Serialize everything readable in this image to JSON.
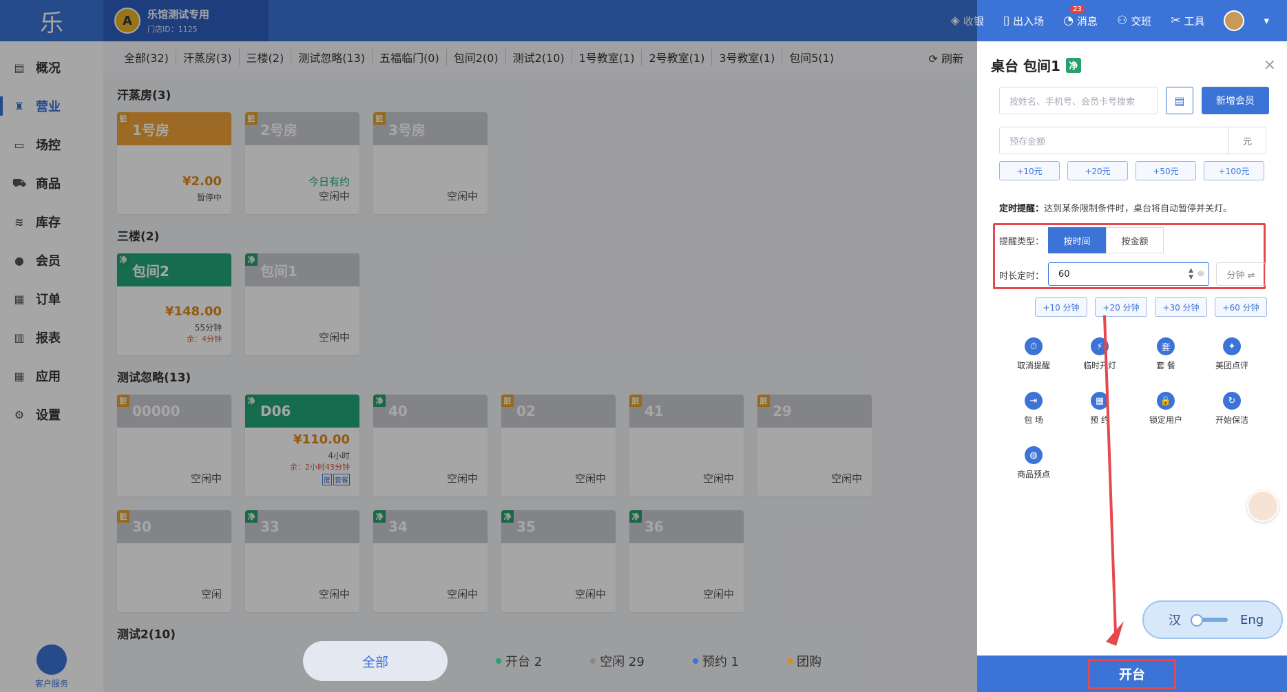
{
  "topbar": {
    "logo": "乐",
    "store_avatar": "A",
    "store_name": "乐馆测试专用",
    "store_id": "门店ID：1125",
    "actions": [
      {
        "icon": "cashier-icon",
        "label": "收银"
      },
      {
        "icon": "door-icon",
        "label": "出入场"
      },
      {
        "icon": "bell-icon",
        "label": "消息",
        "badge": "23"
      },
      {
        "icon": "handover-icon",
        "label": "交班"
      },
      {
        "icon": "tools-icon",
        "label": "工具"
      }
    ]
  },
  "sidebar": {
    "items": [
      {
        "icon": "chart-icon",
        "label": "概况"
      },
      {
        "icon": "money-bag-icon",
        "label": "营业",
        "active": true
      },
      {
        "icon": "venue-icon",
        "label": "场控"
      },
      {
        "icon": "cart-icon",
        "label": "商品"
      },
      {
        "icon": "stack-icon",
        "label": "库存"
      },
      {
        "icon": "member-icon",
        "label": "会员"
      },
      {
        "icon": "order-icon",
        "label": "订单"
      },
      {
        "icon": "report-icon",
        "label": "报表"
      },
      {
        "icon": "apps-icon",
        "label": "应用"
      },
      {
        "icon": "gear-icon",
        "label": "设置"
      }
    ],
    "service_label": "客户服务"
  },
  "filters": [
    "全部(32)",
    "汗蒸房(3)",
    "三楼(2)",
    "测试忽略(13)",
    "五福临门(0)",
    "包间2(0)",
    "测试2(10)",
    "1号教室(1)",
    "2号教室(1)",
    "3号教室(1)",
    "包间5(1)"
  ],
  "refresh_label": "刷新",
  "sections": [
    {
      "title": "汗蒸房(3)",
      "cards": [
        {
          "tag": "脏",
          "tag_type": "dirty",
          "name": "1号房",
          "head": "orange",
          "price": "¥2.00",
          "status": "暂停中"
        },
        {
          "tag": "脏",
          "tag_type": "dirty",
          "name": "2号房",
          "head": "gray",
          "reserve": "今日有约",
          "status": "空闲中"
        },
        {
          "tag": "脏",
          "tag_type": "dirty",
          "name": "3号房",
          "head": "gray",
          "status": "空闲中"
        }
      ]
    },
    {
      "title": "三楼(2)",
      "cards": [
        {
          "tag": "净",
          "tag_type": "clean",
          "name": "包间2",
          "head": "green",
          "price": "¥148.00",
          "status": "55分钟",
          "remain": "余：4分钟"
        },
        {
          "tag": "净",
          "tag_type": "clean",
          "name": "包间1",
          "head": "gray",
          "status": "空闲中"
        }
      ]
    },
    {
      "title": "测试忽略(13)",
      "cards": [
        {
          "tag": "脏",
          "tag_type": "dirty",
          "name": "00000",
          "head": "gray",
          "status": "空闲中"
        },
        {
          "tag": "净",
          "tag_type": "clean",
          "name": "D06",
          "head": "green",
          "price": "¥110.00",
          "status": "4小时",
          "remain": "余：2小时43分钟",
          "mini": [
            "匿",
            "套餐"
          ]
        },
        {
          "tag": "净",
          "tag_type": "clean",
          "name": "40",
          "head": "gray",
          "status": "空闲中"
        },
        {
          "tag": "脏",
          "tag_type": "dirty",
          "name": "02",
          "head": "gray",
          "status": "空闲中"
        },
        {
          "tag": "脏",
          "tag_type": "dirty",
          "name": "41",
          "head": "gray",
          "status": "空闲中"
        },
        {
          "tag": "脏",
          "tag_type": "dirty",
          "name": "29",
          "head": "gray",
          "status": "空闲中"
        },
        {
          "tag": "脏",
          "tag_type": "dirty",
          "name": "30",
          "head": "gray",
          "status": "空闲"
        },
        {
          "tag": "净",
          "tag_type": "clean",
          "name": "33",
          "head": "gray",
          "status": "空闲中"
        },
        {
          "tag": "净",
          "tag_type": "clean",
          "name": "34",
          "head": "gray",
          "status": "空闲中"
        },
        {
          "tag": "净",
          "tag_type": "clean",
          "name": "35",
          "head": "gray",
          "status": "空闲中"
        },
        {
          "tag": "净",
          "tag_type": "clean",
          "name": "36",
          "head": "gray",
          "status": "空闲中"
        }
      ]
    },
    {
      "title": "测试2(10)",
      "cards": []
    }
  ],
  "bottom": {
    "all_label": "全部",
    "stats": [
      {
        "label": "开台 2",
        "color": "#27a06a"
      },
      {
        "label": "空闲 29",
        "color": "#888888"
      },
      {
        "label": "预约 1",
        "color": "#3b73d6"
      },
      {
        "label": "团购",
        "color": "#e08a1a"
      }
    ]
  },
  "panel": {
    "title": "桌台 包间1",
    "clean_badge": "净",
    "close": "×",
    "search_placeholder": "按姓名、手机号、会员卡号搜索",
    "add_member": "新增会员",
    "deposit_placeholder": "预存金额",
    "deposit_unit": "元",
    "deposit_quick": [
      "+10元",
      "+20元",
      "+50元",
      "+100元"
    ],
    "reminder_label": "定时提醒：",
    "reminder_text": "达到某条限制条件时，桌台将自动暂停并关灯。",
    "type_label": "提醒类型：",
    "type_options": [
      "按时间",
      "按金额"
    ],
    "type_selected": "按时间",
    "duration_label": "时长定时：",
    "duration_value": "60",
    "duration_unit": "分钟 ⇌",
    "duration_quick": [
      "+10 分钟",
      "+20 分钟",
      "+30 分钟",
      "+60 分钟"
    ],
    "actions": [
      {
        "icon": "timer-cancel-icon",
        "label": "取消提醒"
      },
      {
        "icon": "flash-icon",
        "label": "临时开灯"
      },
      {
        "icon": "package-icon",
        "label": "套 餐"
      },
      {
        "icon": "meituan-icon",
        "label": "美团点评"
      },
      {
        "icon": "enter-icon",
        "label": "包 场"
      },
      {
        "icon": "calendar-icon",
        "label": "预 约"
      },
      {
        "icon": "lock-icon",
        "label": "锁定用户"
      },
      {
        "icon": "refresh-icon",
        "label": "开始保洁"
      },
      {
        "icon": "product-icon",
        "label": "商品预点"
      }
    ],
    "lang_left": "汉",
    "lang_right": "Eng",
    "open_button": "开台"
  }
}
